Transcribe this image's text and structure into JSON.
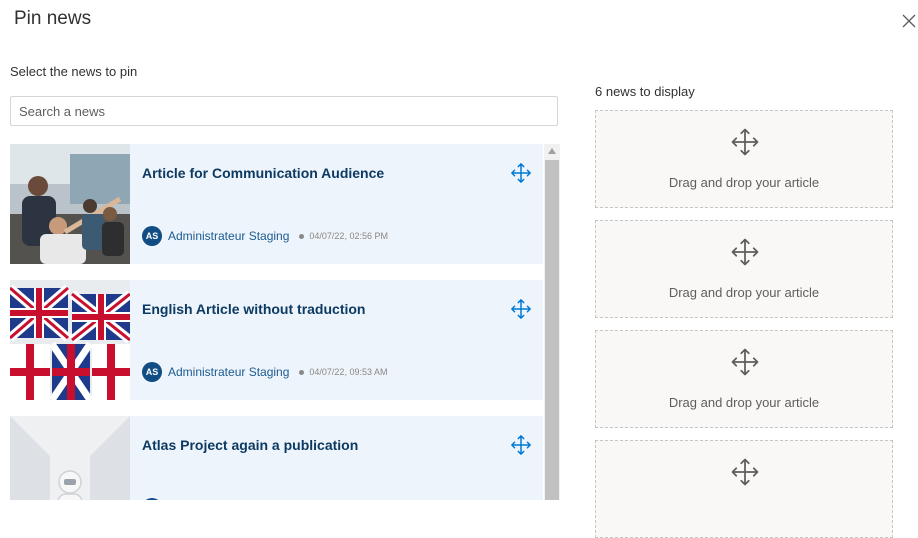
{
  "dialog": {
    "title": "Pin news",
    "close_icon": "close-icon"
  },
  "left": {
    "select_label": "Select the news to pin",
    "search_placeholder": "Search a news",
    "articles": [
      {
        "title": "Article for Communication Audience",
        "author_initials": "AS",
        "author": "Administrateur Staging",
        "date": "04/07/22, 02:56 PM",
        "image": "office-meeting-photo"
      },
      {
        "title": "English Article without traduction",
        "author_initials": "AS",
        "author": "Administrateur Staging",
        "date": "04/07/22, 09:53 AM",
        "image": "union-jack-flags-photo"
      },
      {
        "title": "Atlas Project again a publication",
        "author_initials": "AS",
        "author": "",
        "date": "",
        "image": "astronaut-photo"
      }
    ]
  },
  "right": {
    "count_label": "6 news to display",
    "slots": [
      {
        "text": "Drag and drop your article"
      },
      {
        "text": "Drag and drop your article"
      },
      {
        "text": "Drag and drop your article"
      },
      {
        "text": ""
      }
    ]
  },
  "colors": {
    "card_bg": "#eef4fb",
    "title": "#0c3a62",
    "accent": "#0078d4",
    "avatar": "#114d84"
  }
}
